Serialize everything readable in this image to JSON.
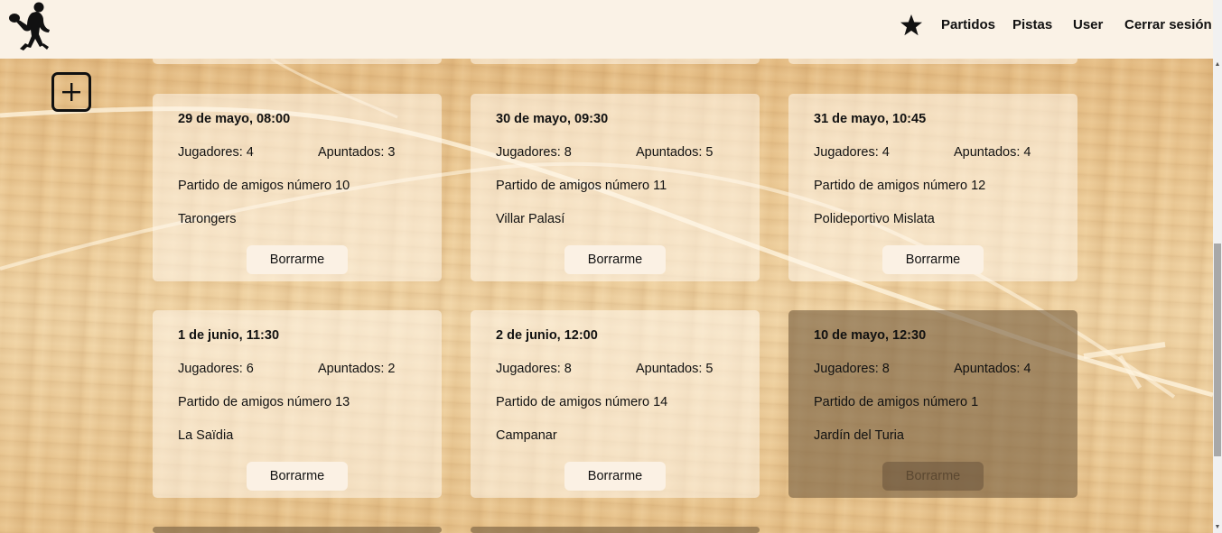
{
  "header": {
    "nav": {
      "favorites_icon": "star-icon",
      "partidos": "Partidos",
      "pistas": "Pistas",
      "user": "User",
      "logout": "Cerrar sesión"
    },
    "logo_icon": "padel-player-silhouette"
  },
  "add_button": {
    "icon": "plus-icon"
  },
  "matches": [
    {
      "date": "29 de mayo, 08:00",
      "jugadores": "Jugadores: 4",
      "apuntados": "Apuntados: 3",
      "name": "Partido de amigos número 10",
      "place": "Tarongers",
      "button": "Borrarme",
      "past": false
    },
    {
      "date": "30 de mayo, 09:30",
      "jugadores": "Jugadores: 8",
      "apuntados": "Apuntados: 5",
      "name": "Partido de amigos número 11",
      "place": "Villar Palasí",
      "button": "Borrarme",
      "past": false
    },
    {
      "date": "31 de mayo, 10:45",
      "jugadores": "Jugadores: 4",
      "apuntados": "Apuntados: 4",
      "name": "Partido de amigos número 12",
      "place": "Polideportivo Mislata",
      "button": "Borrarme",
      "past": false
    },
    {
      "date": "1 de junio, 11:30",
      "jugadores": "Jugadores: 6",
      "apuntados": "Apuntados: 2",
      "name": "Partido de amigos número 13",
      "place": "La Saïdia",
      "button": "Borrarme",
      "past": false
    },
    {
      "date": "2 de junio, 12:00",
      "jugadores": "Jugadores: 8",
      "apuntados": "Apuntados: 5",
      "name": "Partido de amigos número 14",
      "place": "Campanar",
      "button": "Borrarme",
      "past": false
    },
    {
      "date": "10 de mayo, 12:30",
      "jugadores": "Jugadores: 8",
      "apuntados": "Apuntados: 4",
      "name": "Partido de amigos número 1",
      "place": "Jardín del Turia",
      "button": "Borrarme",
      "past": true
    }
  ]
}
